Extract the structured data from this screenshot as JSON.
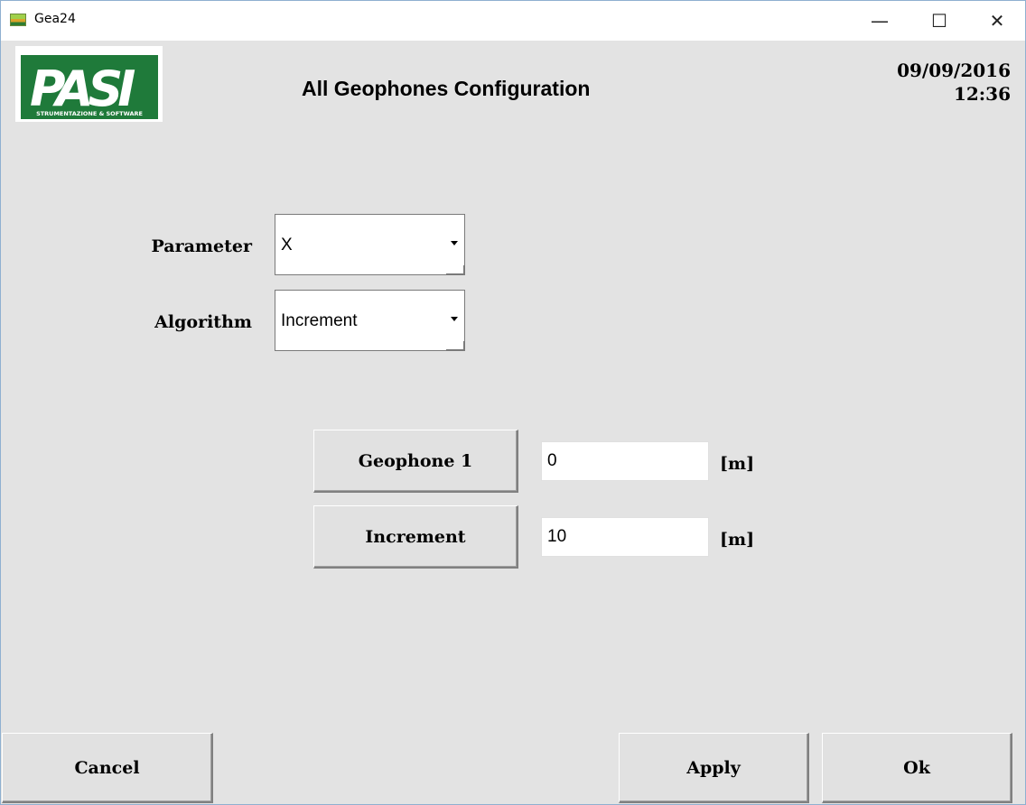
{
  "window": {
    "title": "Gea24",
    "minimize_glyph": "—",
    "maximize_glyph": "☐",
    "close_glyph": "✕"
  },
  "logo": {
    "letters": "PASI",
    "tagline": "STRUMENTAZIONE & SOFTWARE"
  },
  "header": {
    "title": "All Geophones Configuration",
    "date": "09/09/2016",
    "time": "12:36"
  },
  "form": {
    "parameter": {
      "label": "Parameter",
      "value": "X"
    },
    "algorithm": {
      "label": "Algorithm",
      "value": "Increment"
    }
  },
  "values": {
    "geophone1": {
      "button_label": "Geophone 1",
      "value": "0",
      "unit": "[m]"
    },
    "increment": {
      "button_label": "Increment",
      "value": "10",
      "unit": "[m]"
    }
  },
  "footer": {
    "cancel_label": "Cancel",
    "apply_label": "Apply",
    "ok_label": "Ok"
  },
  "colors": {
    "background": "#e3e3e3",
    "logo_green": "#1f7a3a"
  }
}
